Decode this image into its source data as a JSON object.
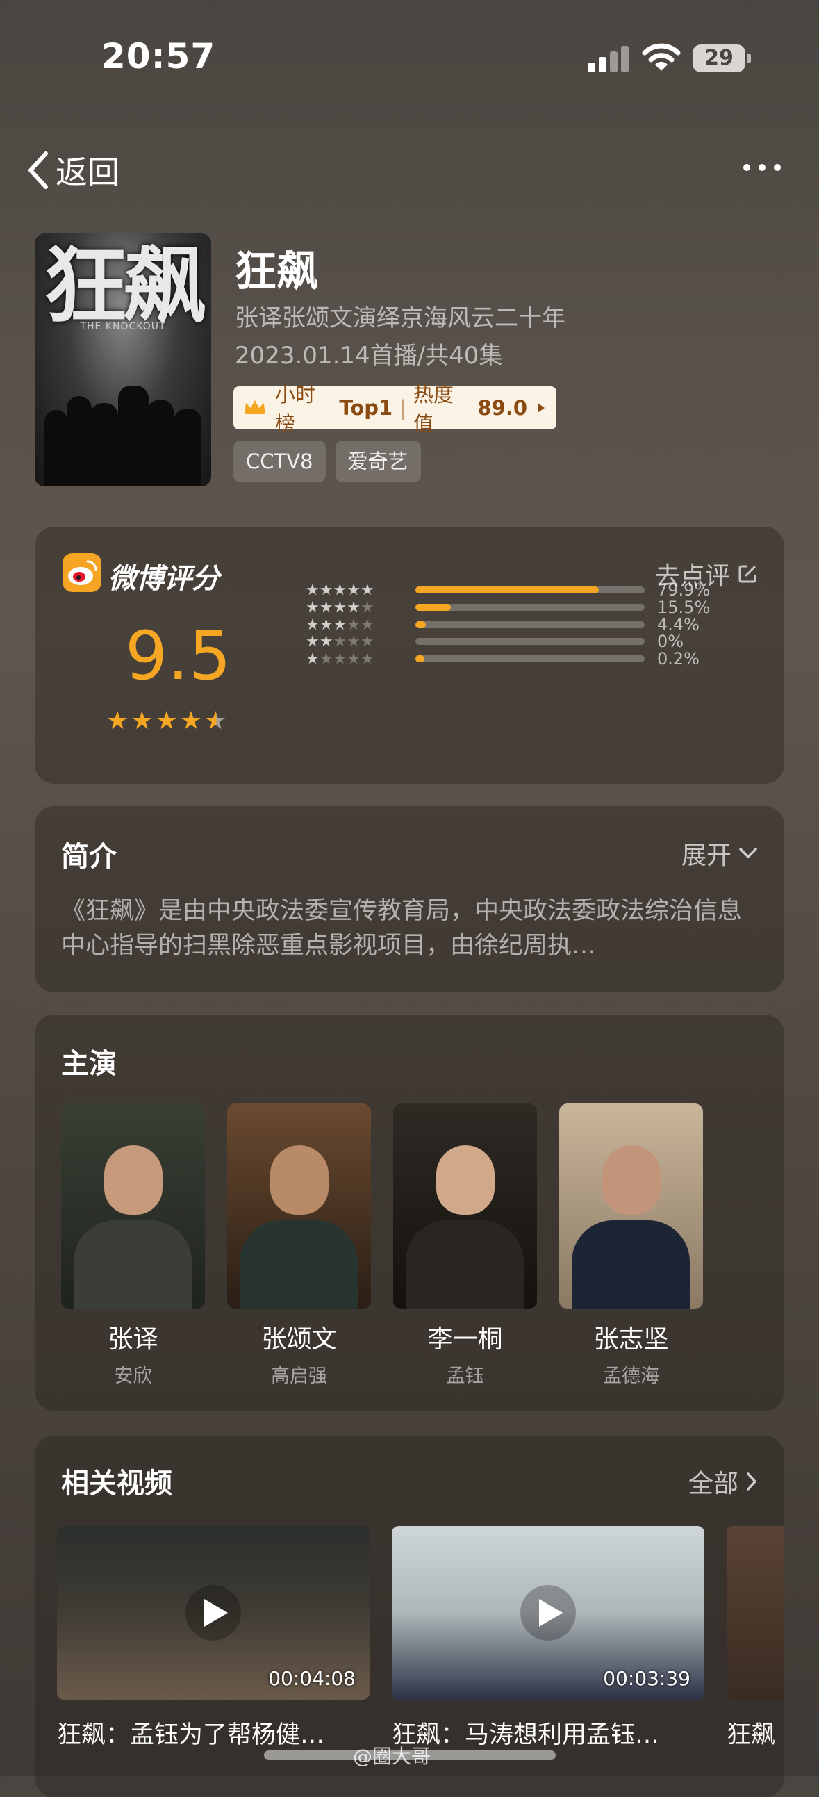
{
  "status_bar": {
    "time": "20:57",
    "battery": "29"
  },
  "nav": {
    "back_label": "返回"
  },
  "show": {
    "poster_title": "狂飙",
    "poster_subtitle": "THE KNOCKOUT",
    "title": "狂飙",
    "subtitle": "张译张颂文演绎京海风云二十年",
    "date_info": "2023.01.14首播/共40集",
    "rank_label": "小时榜",
    "rank_value": "Top1",
    "heat_label": "热度值",
    "heat_value": "89.0",
    "tags": [
      "CCTV8",
      "爱奇艺"
    ]
  },
  "rating": {
    "brand": "微博评分",
    "rate_link": "去点评",
    "score": "9.5",
    "stars": 4.5,
    "distribution": [
      {
        "stars": 5,
        "percent": "79.9%",
        "value": 79.9
      },
      {
        "stars": 4,
        "percent": "15.5%",
        "value": 15.5
      },
      {
        "stars": 3,
        "percent": "4.4%",
        "value": 4.4
      },
      {
        "stars": 2,
        "percent": "0%",
        "value": 0
      },
      {
        "stars": 1,
        "percent": "0.2%",
        "value": 0.2
      }
    ]
  },
  "intro": {
    "title": "简介",
    "expand_label": "展开",
    "text": "《狂飙》是由中央政法委宣传教育局，中央政法委政法综治信息中心指导的扫黑除恶重点影视项目，由徐纪周执…"
  },
  "cast": {
    "title": "主演",
    "members": [
      {
        "name": "张译",
        "role": "安欣"
      },
      {
        "name": "张颂文",
        "role": "高启强"
      },
      {
        "name": "李一桐",
        "role": "孟钰"
      },
      {
        "name": "张志坚",
        "role": "孟德海"
      }
    ]
  },
  "videos": {
    "title": "相关视频",
    "all_label": "全部",
    "items": [
      {
        "duration": "00:04:08",
        "title": "狂飙：孟钰为了帮杨健…"
      },
      {
        "duration": "00:03:39",
        "title": "狂飙：马涛想利用孟钰…"
      },
      {
        "duration": "",
        "title": "狂飙"
      }
    ]
  },
  "watermark": "@圈大哥",
  "colors": {
    "accent": "#f5a623",
    "badge_bg": "#fbf3e5",
    "badge_text": "#8a4b12"
  }
}
